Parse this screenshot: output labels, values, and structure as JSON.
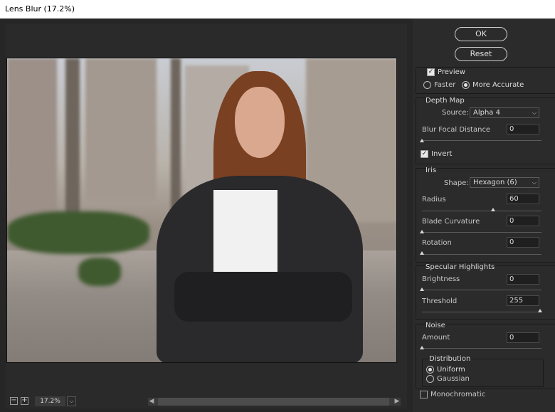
{
  "window": {
    "title": "Lens Blur (17.2%)"
  },
  "buttons": {
    "ok": "OK",
    "reset": "Reset"
  },
  "preview": {
    "label": "Preview",
    "checked": true,
    "modes": [
      {
        "label": "Faster",
        "selected": false
      },
      {
        "label": "More Accurate",
        "selected": true
      }
    ]
  },
  "depth_map": {
    "title": "Depth Map",
    "source_label": "Source:",
    "source_value": "Alpha 4",
    "focal_label": "Blur Focal Distance",
    "focal_value": "0",
    "focal_level": 0,
    "invert_label": "Invert",
    "invert_checked": true
  },
  "iris": {
    "title": "Iris",
    "shape_label": "Shape:",
    "shape_value": "Hexagon (6)",
    "radius_label": "Radius",
    "radius_value": "60",
    "radius_level": 0.6,
    "curvature_label": "Blade Curvature",
    "curvature_value": "0",
    "curvature_level": 0,
    "rotation_label": "Rotation",
    "rotation_value": "0",
    "rotation_level": 0
  },
  "specular": {
    "title": "Specular Highlights",
    "brightness_label": "Brightness",
    "brightness_value": "0",
    "brightness_level": 0,
    "threshold_label": "Threshold",
    "threshold_value": "255",
    "threshold_level": 1
  },
  "noise": {
    "title": "Noise",
    "amount_label": "Amount",
    "amount_value": "0",
    "amount_level": 0,
    "distribution_title": "Distribution",
    "distribution": [
      {
        "label": "Uniform",
        "selected": true
      },
      {
        "label": "Gaussian",
        "selected": false
      }
    ],
    "mono_label": "Monochromatic",
    "mono_checked": false
  },
  "status": {
    "zoom": "17.2%",
    "zoom_out": "−",
    "zoom_in": "+"
  },
  "icons": {
    "check": "✓",
    "chevron": "⌵",
    "left": "◀",
    "right": "▶"
  }
}
